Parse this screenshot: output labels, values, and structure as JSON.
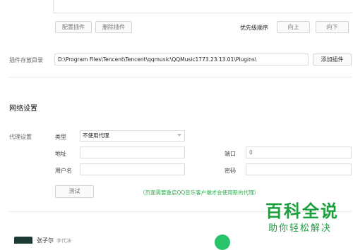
{
  "plugins": {
    "config_button": "配置插件",
    "delete_button": "删除插件",
    "priority_label": "优先级顺序",
    "up_button": "向上",
    "down_button": "向下",
    "storage_label": "插件存放目录",
    "storage_path": "D:\\Program Files\\Tencent\\Tencent\\qqmusic\\QQMusic1773.23.13.01\\Plugins\\",
    "add_button": "添加插件"
  },
  "network": {
    "title": "网络设置",
    "proxy_label": "代理设置",
    "type_label": "类型",
    "type_value": "不使用代理",
    "address_label": "地址",
    "address_value": "",
    "port_label": "端口",
    "port_value": "0",
    "username_label": "用户名",
    "username_value": "",
    "password_label": "密码",
    "password_value": "",
    "test_button": "测试",
    "hint": "（页面需要重启QQ音乐客户端才会使用新的代理）"
  },
  "bottom": {
    "name": "张子尔",
    "sub": "李代沫"
  },
  "watermark": {
    "title": "百科全说",
    "subtitle": "助你轻松解决"
  }
}
